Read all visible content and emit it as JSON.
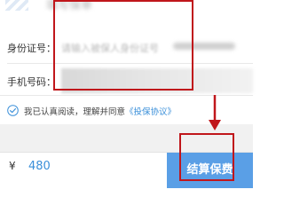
{
  "header": {
    "title": "填写保单"
  },
  "form": {
    "id_label": "身份证号：",
    "id_placeholder": "请输入被保人身份证号",
    "phone_label": "手机号码：",
    "phone_value": ""
  },
  "agreement": {
    "text": "我已认真阅读，理解并同意",
    "link": "《投保协议》",
    "checked": true
  },
  "footer": {
    "currency": "¥",
    "price": "480",
    "settle_label": "结算保费"
  },
  "colors": {
    "accent_blue": "#3a8fd9",
    "button_blue": "#5a9fe6",
    "annotation_red": "#c0161b"
  },
  "icons": {
    "check": "check-circle-icon",
    "arrow": "arrow-down-icon"
  }
}
